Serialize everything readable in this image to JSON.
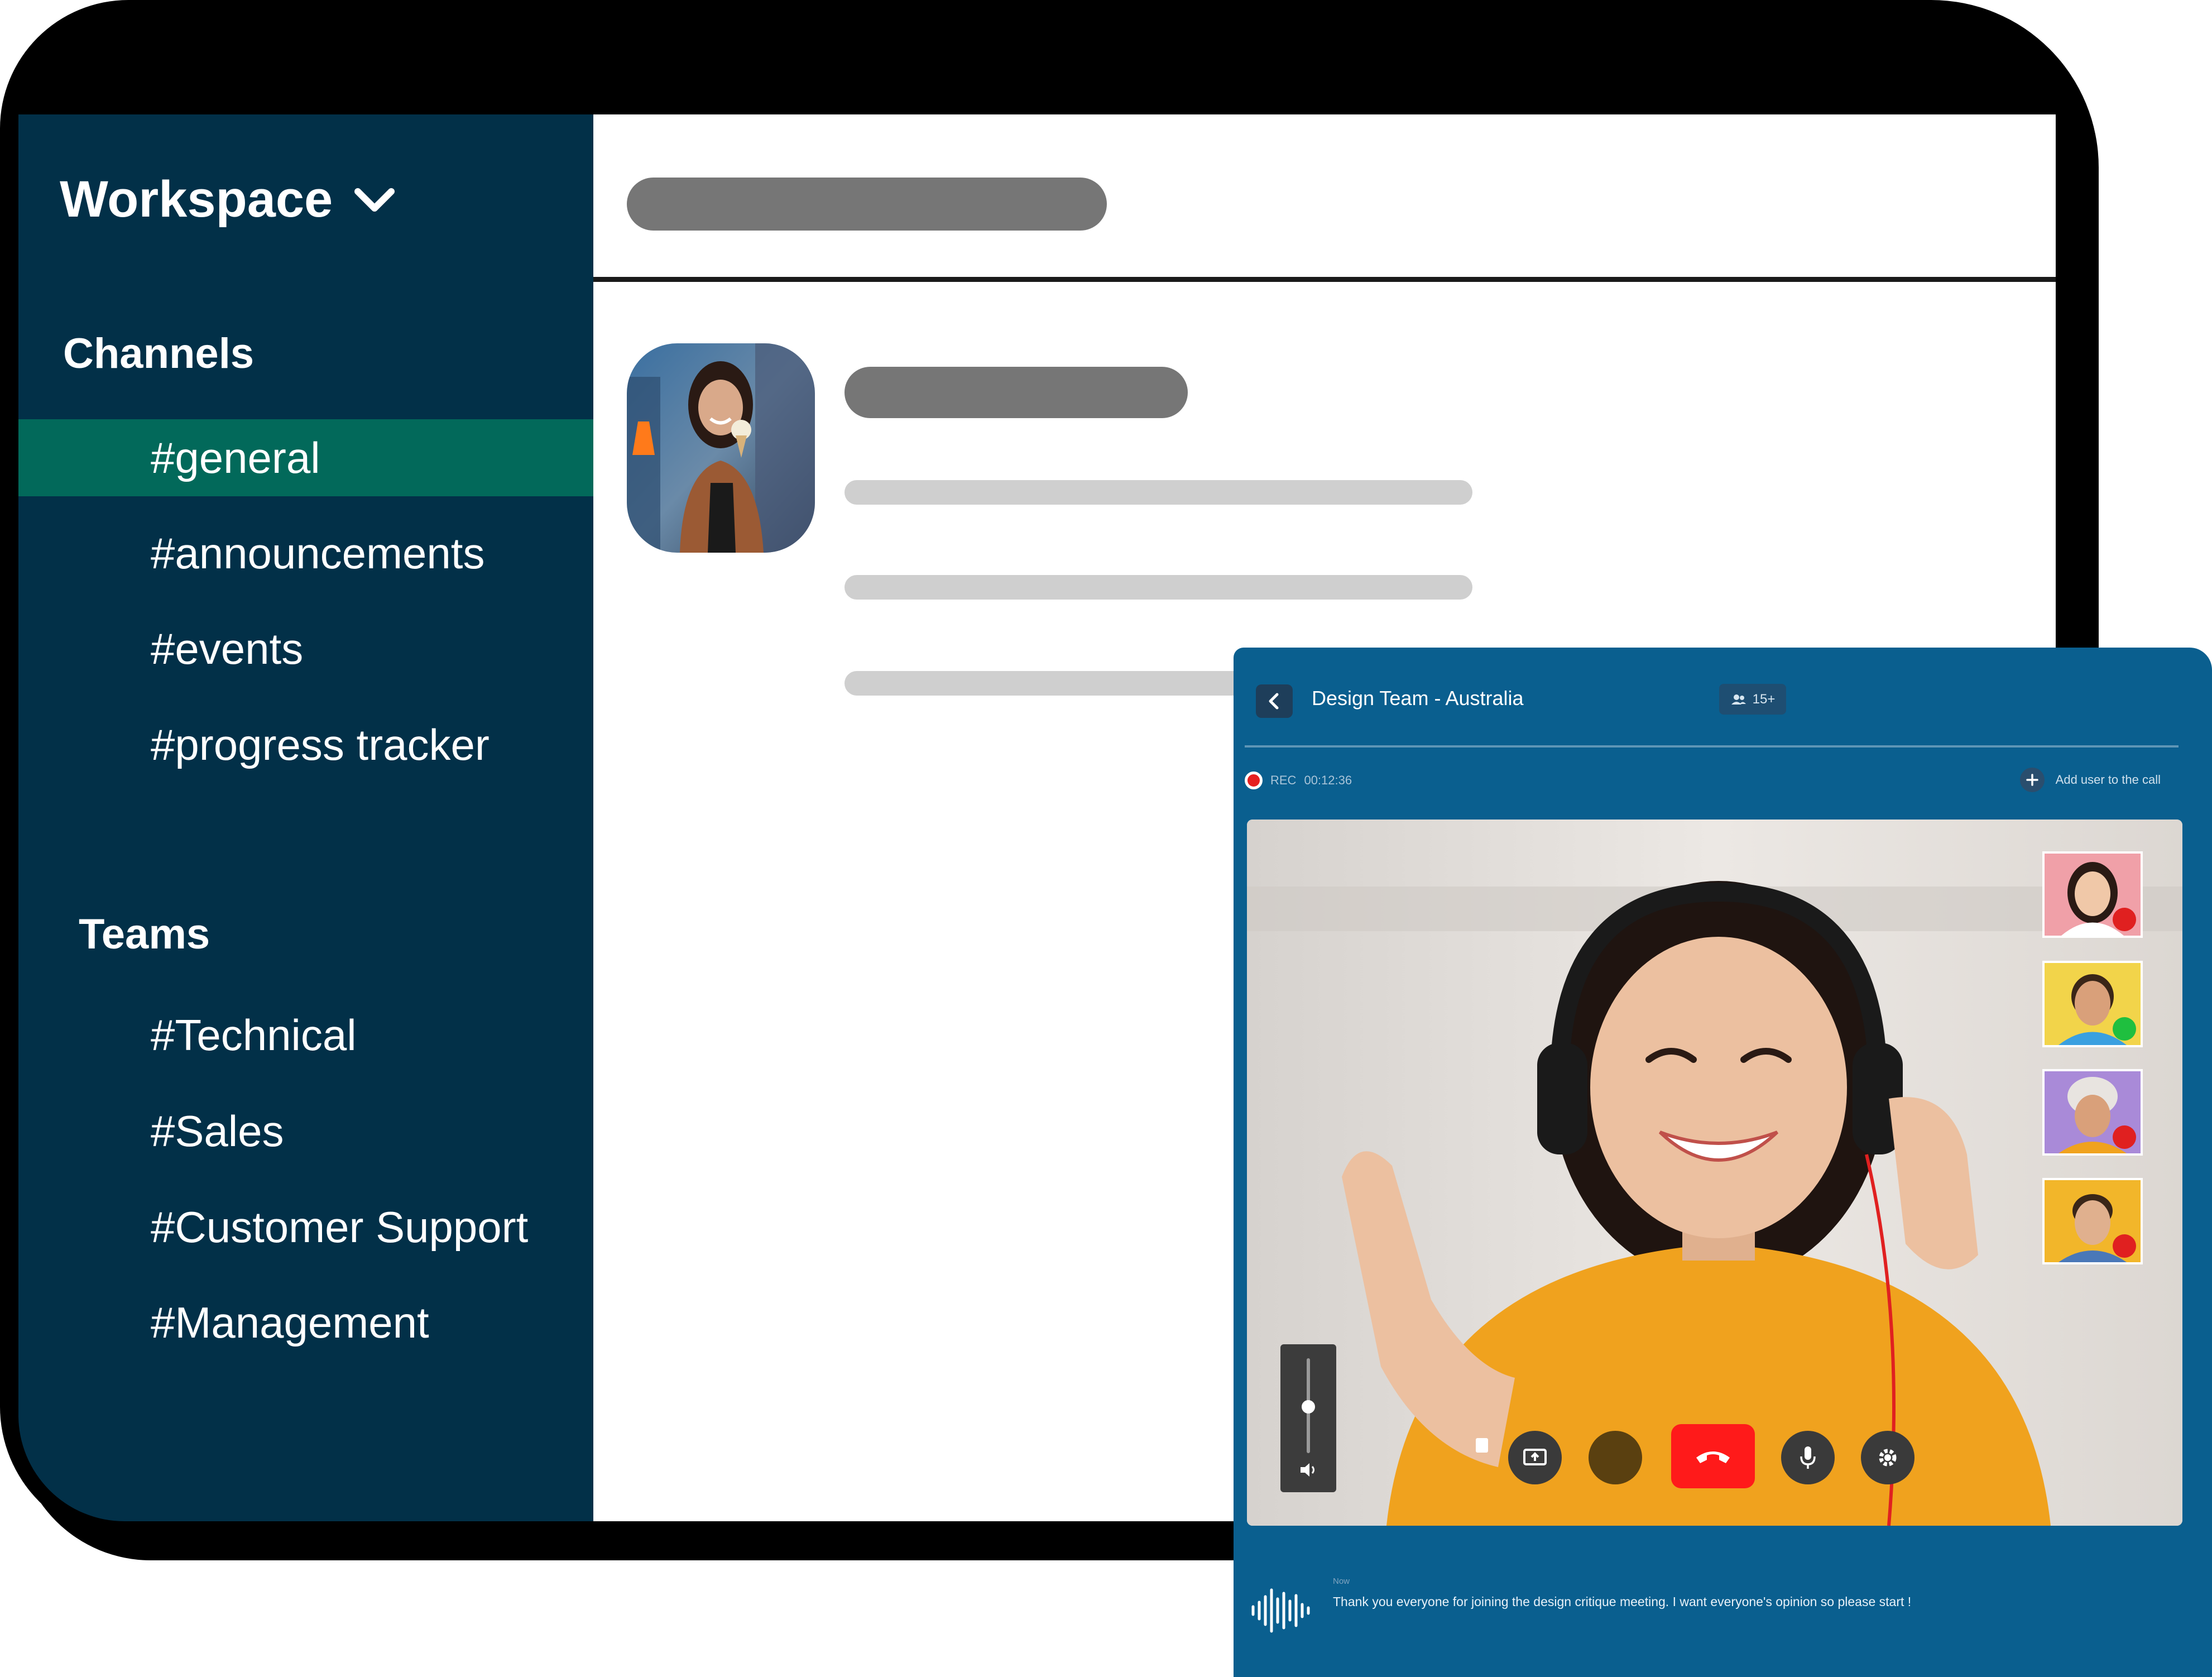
{
  "sidebar": {
    "workspace_title": "Workspace",
    "channels_heading": "Channels",
    "channels": [
      {
        "label": "#general",
        "active": true
      },
      {
        "label": "#announcements",
        "active": false
      },
      {
        "label": "#events",
        "active": false
      },
      {
        "label": "#progress tracker",
        "active": false
      }
    ],
    "teams_heading": "Teams",
    "teams": [
      {
        "label": "#Technical"
      },
      {
        "label": "#Sales"
      },
      {
        "label": "#Customer Support"
      },
      {
        "label": "#Management"
      }
    ]
  },
  "call": {
    "title": "Design Team - Australia",
    "participants_count": "15+",
    "rec_label": "REC",
    "rec_time": "00:12:36",
    "add_user_label": "Add user to the call",
    "caption_time": "Now",
    "caption_text": "Thank you everyone for joining the design critique meeting. I want everyone's opinion so please start !"
  },
  "colors": {
    "sidebar_bg": "#023048",
    "sidebar_active": "#02695A",
    "call_bg": "#0A5F8F",
    "end_call": "#FF1A1A"
  },
  "icons": [
    "chevron-down-icon",
    "back-arrow-icon",
    "users-icon",
    "plus-icon",
    "volume-icon",
    "screen-share-icon",
    "end-call-icon",
    "microphone-icon",
    "settings-icon",
    "soundwave-icon",
    "mic-muted-icon",
    "mic-active-icon"
  ]
}
